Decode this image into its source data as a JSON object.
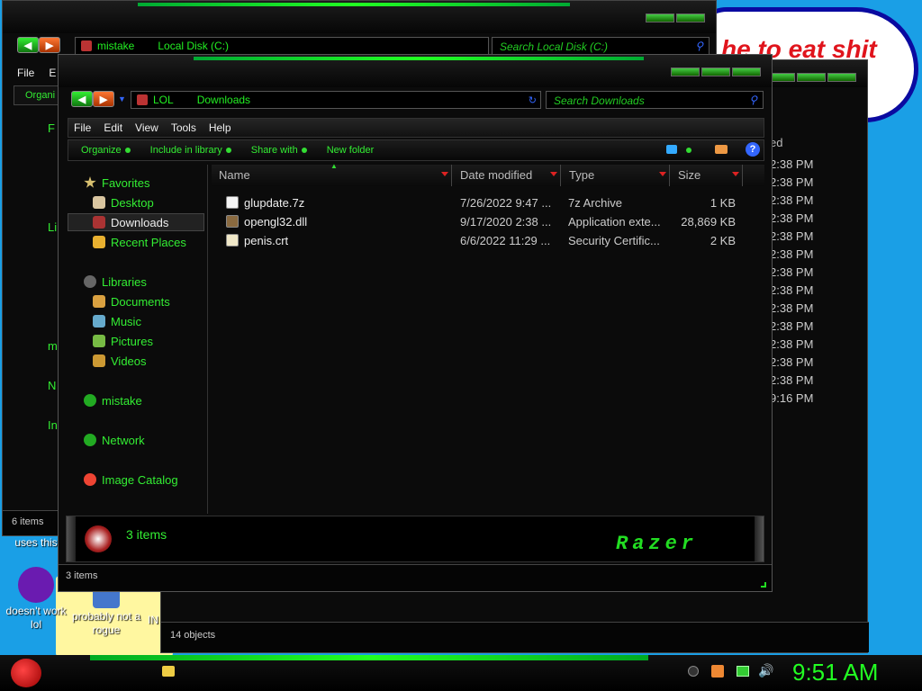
{
  "desktop": {
    "banner_text": "he to eat shit",
    "icons": [
      {
        "label": "uses this",
        "name": "desktop-icon-uses-this"
      },
      {
        "label": "doesn't work lol",
        "name": "desktop-icon-yahoo"
      },
      {
        "label": "probably not a rogue",
        "name": "desktop-icon-rogue"
      },
      {
        "label": "IN",
        "name": "desktop-icon-in"
      }
    ]
  },
  "win_back": {
    "status": "14 objects",
    "header_partial": "ed",
    "times": [
      "2:38 PM",
      "2:38 PM",
      "2:38 PM",
      "2:38 PM",
      "2:38 PM",
      "2:38 PM",
      "2:38 PM",
      "2:38 PM",
      "2:38 PM",
      "2:38 PM",
      "2:38 PM",
      "2:38 PM",
      "2:38 PM",
      "9:16 PM"
    ]
  },
  "win_mid": {
    "address": [
      "mistake",
      "Local Disk (C:)"
    ],
    "search_placeholder": "Search Local Disk (C:)",
    "menu": [
      "File",
      "E"
    ],
    "organize": "Organi",
    "nav_partial": [
      "F",
      "Li",
      "m",
      "N",
      "In"
    ],
    "status": "6 items"
  },
  "win_front": {
    "address": [
      "LOL",
      "Downloads"
    ],
    "search_placeholder": "Search Downloads",
    "menu": [
      "File",
      "Edit",
      "View",
      "Tools",
      "Help"
    ],
    "commands": [
      "Organize",
      "Include in library",
      "Share with",
      "New folder"
    ],
    "nav": {
      "favorites": "Favorites",
      "desktop": "Desktop",
      "downloads": "Downloads",
      "recent": "Recent Places",
      "libraries": "Libraries",
      "documents": "Documents",
      "music": "Music",
      "pictures": "Pictures",
      "videos": "Videos",
      "mistake": "mistake",
      "network": "Network",
      "image_catalog": "Image Catalog"
    },
    "columns": [
      "Name",
      "Date modified",
      "Type",
      "Size"
    ],
    "files": [
      {
        "name": "glupdate.7z",
        "date": "7/26/2022 9:47 ...",
        "type": "7z Archive",
        "size": "1 KB",
        "icon": "archive-icon"
      },
      {
        "name": "opengl32.dll",
        "date": "9/17/2020 2:38 ...",
        "type": "Application exte...",
        "size": "28,869 KB",
        "icon": "dll-icon"
      },
      {
        "name": "penis.crt",
        "date": "6/6/2022 11:29 ...",
        "type": "Security Certific...",
        "size": "2 KB",
        "icon": "certificate-icon"
      }
    ],
    "details_count": "3 items",
    "brand": "Razer",
    "status": "3 items"
  },
  "taskbar": {
    "clock": "9:51 AM"
  }
}
